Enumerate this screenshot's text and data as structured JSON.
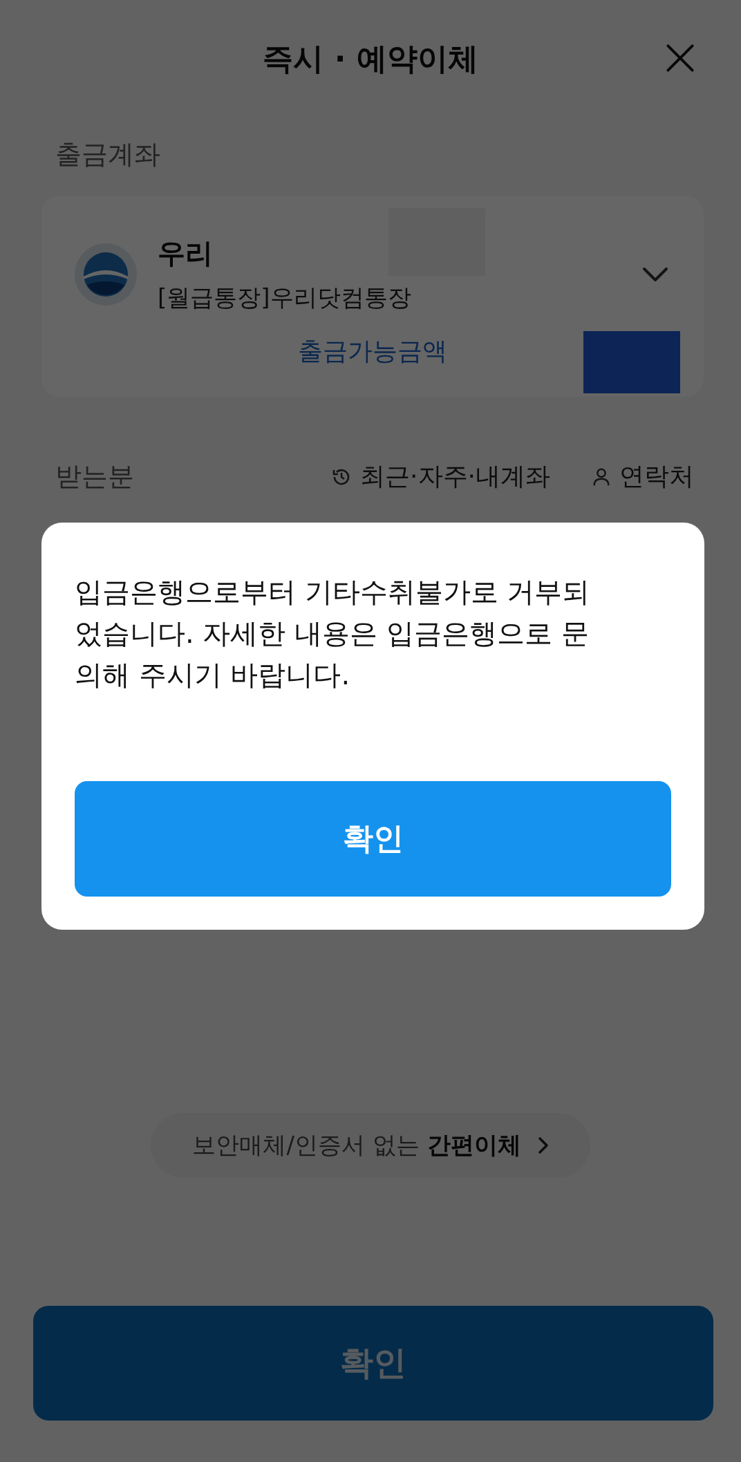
{
  "header": {
    "title": "즉시 · 예약이체"
  },
  "source_account": {
    "label": "출금계좌",
    "bank_name": "우리",
    "account_name": "[월급통장]우리닷컴통장",
    "available_label": "출금가능금액"
  },
  "recipient": {
    "label": "받는분",
    "links": [
      {
        "kind": "history",
        "label": "최근·자주·내계좌"
      },
      {
        "kind": "contacts",
        "label": "연락처"
      }
    ]
  },
  "simple_transfer": {
    "text": "보안매체/인증서 없는 **간편이체**"
  },
  "confirm_button": {
    "label": "확인",
    "disabled": true
  },
  "dialog": {
    "message": "입금은행으로부터 기타수취불가로 거부되었습니다. 자세한 내용은 입금은행으로 문의해 주시기 바랍니다.",
    "button": "확인"
  }
}
